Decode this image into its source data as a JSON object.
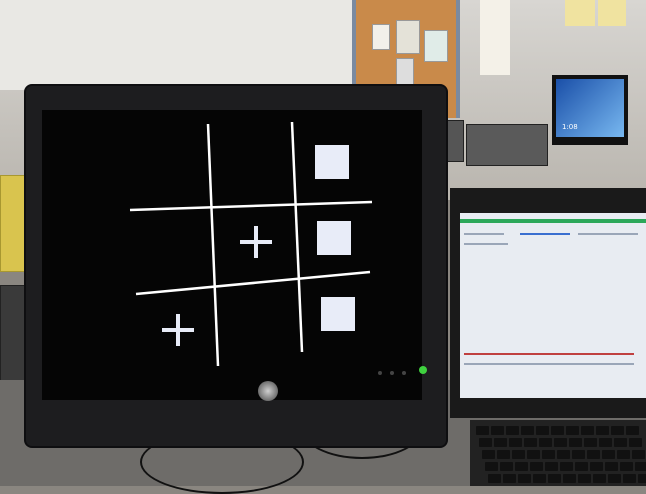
{
  "scene": {
    "description_labels": {
      "far_monitor_time": "1:08"
    }
  },
  "game_board": {
    "grid_size": 3,
    "cells": [
      [
        "empty",
        "empty",
        "square"
      ],
      [
        "empty",
        "plus",
        "square"
      ],
      [
        "plus",
        "empty",
        "square"
      ]
    ]
  },
  "colors": {
    "screen_bg": "#050505",
    "grid_line": "#ffffff",
    "mark": "#e8ecf8",
    "monitor_bezel": "#1d1d1f",
    "power_led": "#3fd13f"
  }
}
